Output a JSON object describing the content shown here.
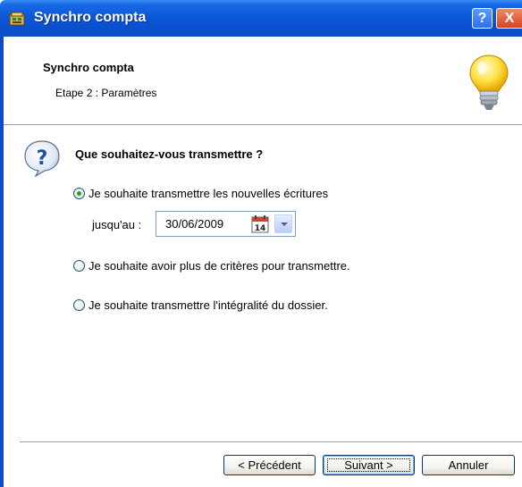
{
  "window": {
    "title": "Synchro compta",
    "help_label": "?",
    "close_label": "X"
  },
  "header": {
    "title": "Synchro compta",
    "step": "Etape 2 : Paramètres"
  },
  "body": {
    "question": "Que souhaitez-vous transmettre ?",
    "options": [
      {
        "label": "Je souhaite transmettre les nouvelles écritures",
        "checked": true
      },
      {
        "label": "Je souhaite avoir plus de critères pour transmettre.",
        "checked": false
      },
      {
        "label": "Je souhaite transmettre l'intégralité du dossier.",
        "checked": false
      }
    ],
    "until_label": "jusqu'au :",
    "date_value": "30/06/2009",
    "calendar_day": "14"
  },
  "footer": {
    "prev_label": "< Précédent",
    "next_label": "Suivant >",
    "cancel_label": "Annuler"
  },
  "colors": {
    "titlebar": "#0a58d8",
    "radio_dot": "#21a121",
    "button_border": "#003c74"
  }
}
